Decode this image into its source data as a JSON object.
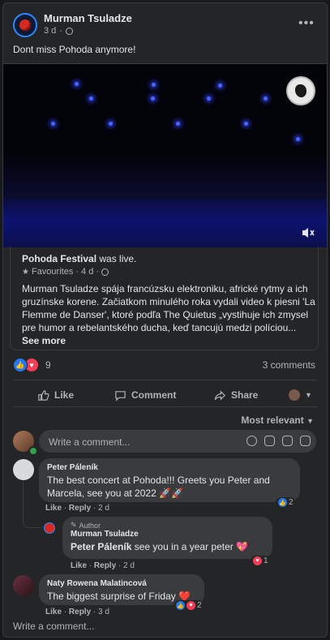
{
  "post": {
    "author": "Murman Tsuladze",
    "time": "3 d",
    "text": "Dont miss Pohoda anymore!",
    "more_label": "•••"
  },
  "shared": {
    "page": "Pohoda Festival",
    "status": " was live.",
    "sub_label": "Favourites",
    "sub_time": "· 4 d ·",
    "body": "Murman Tsuladze spája francúzsku elektroniku, africké rytmy a ich gruzínske korene. Začiatkom minulého roka vydali video k piesni 'La Flemme de Danser', ktoré podľa The Quietus „vystihuje ich zmysel pre humor a rebelantského ducha, keď tancujú medzi políciou...",
    "see_more": "See more"
  },
  "stats": {
    "reaction_count": "9",
    "comments": "3 comments"
  },
  "actions": {
    "like": "Like",
    "comment": "Comment",
    "share": "Share"
  },
  "sort": {
    "label": "Most relevant"
  },
  "composer": {
    "placeholder": "Write a comment..."
  },
  "comments": [
    {
      "author": "Peter Páleník",
      "text": "The best concert at Pohoda!!! Greets you Peter and Marcela, see you at 2022 🚀🚀",
      "like": "Like",
      "reply": "Reply",
      "time": "2 d",
      "reactions": "2"
    },
    {
      "tag": "Author",
      "author": "Murman Tsuladze",
      "mention": "Peter Páleník",
      "text": " see you in a year peter 💖",
      "like": "Like",
      "reply": "Reply",
      "time": "2 d",
      "reactions": "1"
    },
    {
      "author": "Naty Rowena Malatincová",
      "text": "The biggest surprise of Friday ❤️",
      "like": "Like",
      "reply": "Reply",
      "time": "3 d",
      "reactions": "2"
    }
  ],
  "footer": {
    "write_comment": "Write a comment..."
  },
  "icons": {
    "globe": "globe-icon",
    "mute": "speaker-muted-icon",
    "like": "thumbs-up-icon",
    "comment": "speech-bubble-icon",
    "share": "share-arrow-icon",
    "caret": "caret-down-icon"
  },
  "colors": {
    "background": "#18191a",
    "card": "#242526",
    "bubble": "#3a3b3c",
    "text": "#e4e6eb",
    "muted": "#b0b3b8",
    "like_blue": "#2078f4",
    "love_red": "#f33e58"
  }
}
